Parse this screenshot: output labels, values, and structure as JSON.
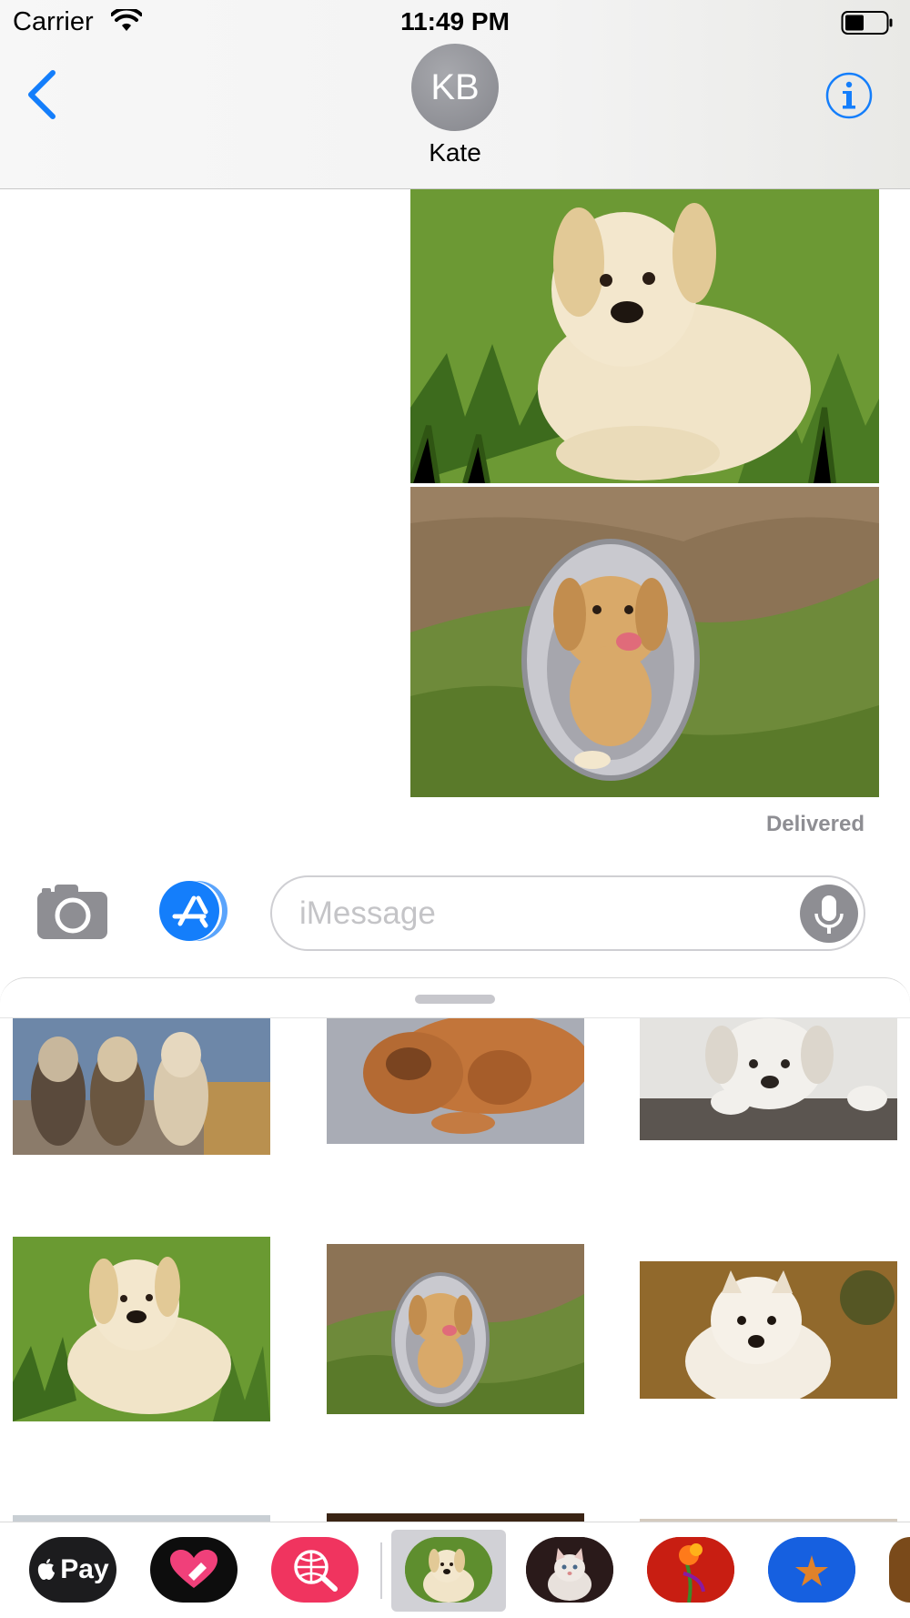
{
  "status_bar": {
    "carrier": "Carrier",
    "time": "11:49 PM"
  },
  "header": {
    "avatar_initials": "KB",
    "contact_name": "Kate"
  },
  "messages": {
    "status": "Delivered"
  },
  "input": {
    "placeholder": "iMessage"
  },
  "app_strip": {
    "apple_pay_label": "Pay"
  },
  "colors": {
    "accent": "#147efb",
    "avatar": "#8e8f95",
    "mic": "#8e8e93"
  }
}
